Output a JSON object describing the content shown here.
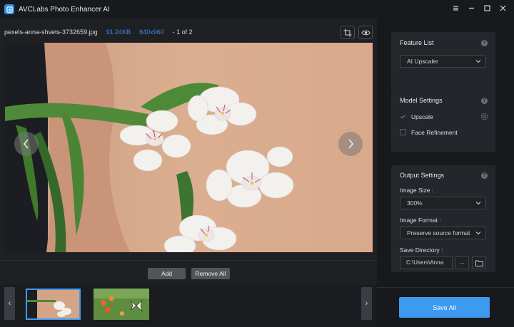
{
  "app": {
    "title": "AVCLabs Photo Enhancer AI"
  },
  "window_controls": {
    "icons": [
      "menu-icon",
      "minimize-icon",
      "maximize-icon",
      "close-icon"
    ]
  },
  "file_info": {
    "name": "pexels-anna-shvets-3732659.jpg",
    "size": "91.24KB",
    "dimensions": "640x960",
    "index": "1 of 2"
  },
  "viewer": {
    "toolbar_icons": [
      "fit-icon",
      "zoom-in-icon",
      "zoom-out-icon",
      "crop-icon",
      "delete-icon",
      "rotate-left-icon",
      "rotate-right-icon"
    ]
  },
  "actions": {
    "add": "Add",
    "remove_all": "Remove All"
  },
  "feature_list": {
    "title": "Feature List",
    "selected": "AI Upscaler"
  },
  "model_settings": {
    "title": "Model Settings",
    "upscale": "Upscale",
    "upscale_checked": true,
    "face_refinement": "Face Refinement",
    "face_refinement_checked": false
  },
  "output_settings": {
    "title": "Output Settings",
    "image_size_label": "Image Size :",
    "image_size": "300%",
    "image_format_label": "Image Format :",
    "image_format": "Preserve source format",
    "save_directory_label": "Save Directory :",
    "save_directory": "C:\\Users\\Anna",
    "more": "···"
  },
  "save_all": "Save All",
  "colors": {
    "accent": "#3d9af0",
    "info_blue": "#3d8ae6"
  }
}
